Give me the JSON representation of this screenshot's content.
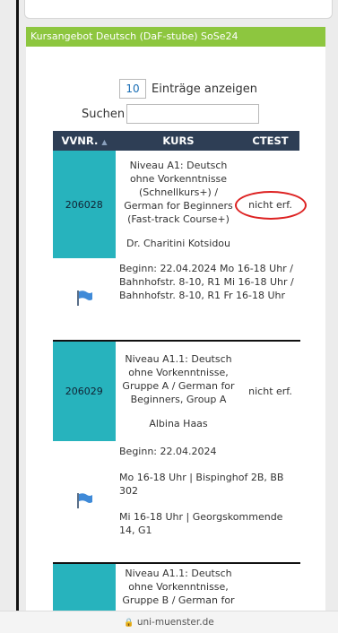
{
  "header": {
    "title": "Kursangebot Deutsch (DaF-stube) SoSe24"
  },
  "length": {
    "value": "10",
    "label": "Einträge anzeigen"
  },
  "search": {
    "label": "Suchen",
    "value": ""
  },
  "table": {
    "headers": [
      "VVNR.",
      "KURS",
      "CTEST"
    ],
    "sort_indicator": "▲",
    "rows": [
      {
        "vvnr": "206028",
        "kurs": "Niveau A1: Deutsch ohne Vorkenntnisse (Schnellkurs+) / German for Beginners (Fast-track Course+)",
        "teacher": "Dr. Charitini Kotsidou",
        "ctest": "nicht erf.",
        "details": [
          "Beginn: 22.04.2024 Mo 16-18 Uhr / Bahnhofstr. 8-10, R1 Mi 16-18 Uhr / Bahnhofstr. 8-10, R1 Fr 16-18 Uhr"
        ]
      },
      {
        "vvnr": "206029",
        "kurs": "Niveau A1.1: Deutsch ohne Vorkenntnisse, Gruppe A / German for Beginners, Group A",
        "teacher": "Albina Haas",
        "ctest": "nicht erf.",
        "details": [
          "Beginn: 22.04.2024",
          "Mo 16-18 Uhr | Bispinghof 2B, BB 302",
          "Mi 16-18 Uhr | Georgskommende 14, G1"
        ]
      },
      {
        "kurs": "Niveau A1.1: Deutsch ohne Vorkenntnisse, Gruppe B / German for"
      }
    ]
  },
  "footer": {
    "domain": "uni-muenster.de",
    "lock_icon": "lock-icon"
  },
  "colors": {
    "header_green": "#8dc63f",
    "table_head": "#2e3e55",
    "vvnr_teal": "#27b3bd",
    "annotation": "#dd2222"
  }
}
